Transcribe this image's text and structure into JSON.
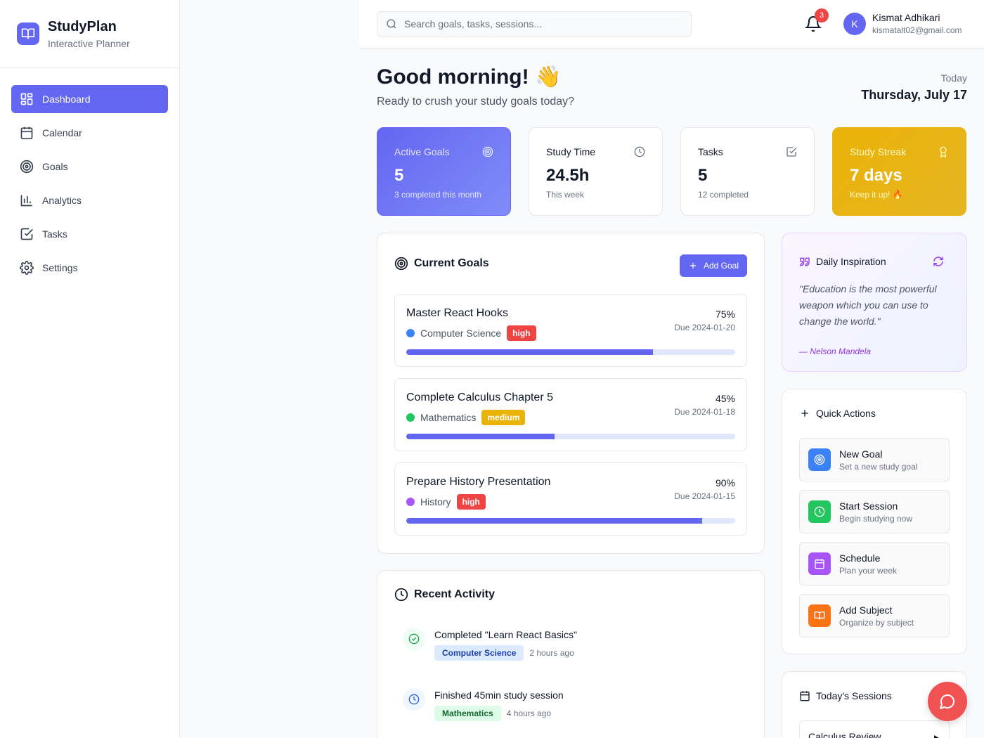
{
  "brand": {
    "title": "StudyPlan",
    "subtitle": "Interactive Planner"
  },
  "nav": [
    {
      "label": "Dashboard",
      "icon": "dashboard-icon",
      "active": true
    },
    {
      "label": "Calendar",
      "icon": "calendar-icon"
    },
    {
      "label": "Goals",
      "icon": "target-icon"
    },
    {
      "label": "Analytics",
      "icon": "bar-chart-icon"
    },
    {
      "label": "Tasks",
      "icon": "check-square-icon"
    },
    {
      "label": "Settings",
      "icon": "gear-icon"
    }
  ],
  "header": {
    "search_placeholder": "Search goals, tasks, sessions...",
    "notification_count": "3",
    "user": {
      "initial": "K",
      "name": "Kismat Adhikari",
      "email": "kismatalt02@gmail.com"
    }
  },
  "greeting": {
    "title": "Good morning! 👋",
    "subtitle": "Ready to crush your study goals today?",
    "today_label": "Today",
    "today_date": "Thursday, July 17"
  },
  "stats": [
    {
      "label": "Active Goals",
      "value": "5",
      "sub": "3 completed this month",
      "icon": "target-icon"
    },
    {
      "label": "Study Time",
      "value": "24.5h",
      "sub": "This week",
      "icon": "clock-icon"
    },
    {
      "label": "Tasks",
      "value": "5",
      "sub": "12 completed",
      "icon": "check-square-icon"
    },
    {
      "label": "Study Streak",
      "value": "7 days",
      "sub": "Keep it up! 🔥",
      "icon": "award-icon"
    }
  ],
  "goals_panel": {
    "title": "Current Goals",
    "add_label": "Add Goal",
    "goals": [
      {
        "name": "Master React Hooks",
        "subject": "Computer Science",
        "subject_color": "#3b82f6",
        "priority": "high",
        "priority_color": "#ef4444",
        "percent_label": "75%",
        "progress": 0.75,
        "due": "Due 2024-01-20"
      },
      {
        "name": "Complete Calculus Chapter 5",
        "subject": "Mathematics",
        "subject_color": "#22c55e",
        "priority": "medium",
        "priority_color": "#eab308",
        "percent_label": "45%",
        "progress": 0.45,
        "due": "Due 2024-01-18"
      },
      {
        "name": "Prepare History Presentation",
        "subject": "History",
        "subject_color": "#a855f7",
        "priority": "high",
        "priority_color": "#ef4444",
        "percent_label": "90%",
        "progress": 0.9,
        "due": "Due 2024-01-15"
      }
    ]
  },
  "activity": {
    "title": "Recent Activity",
    "items": [
      {
        "text": "Completed \"Learn React Basics\"",
        "tag": "Computer Science",
        "time": "2 hours ago",
        "icon": "check-circle-icon"
      },
      {
        "text": "Finished 45min study session",
        "tag": "Mathematics",
        "time": "4 hours ago",
        "icon": "clock-icon"
      }
    ]
  },
  "inspiration": {
    "title": "Daily Inspiration",
    "quote": "\"Education is the most powerful weapon which you can use to change the world.\"",
    "author": "— Nelson Mandela"
  },
  "quick_actions": {
    "title": "Quick Actions",
    "items": [
      {
        "title": "New Goal",
        "sub": "Set a new study goal",
        "color": "#3b82f6",
        "icon": "target-icon"
      },
      {
        "title": "Start Session",
        "sub": "Begin studying now",
        "color": "#22c55e",
        "icon": "clock-icon"
      },
      {
        "title": "Schedule",
        "sub": "Plan your week",
        "color": "#a855f7",
        "icon": "calendar-icon"
      },
      {
        "title": "Add Subject",
        "sub": "Organize by subject",
        "color": "#f97316",
        "icon": "book-icon"
      }
    ]
  },
  "sessions": {
    "title": "Today's Sessions",
    "items": [
      {
        "title": "Calculus Review"
      }
    ]
  },
  "colors": {
    "accent": "#6366f1",
    "streak": "#eab308",
    "fab": "#f05252"
  }
}
